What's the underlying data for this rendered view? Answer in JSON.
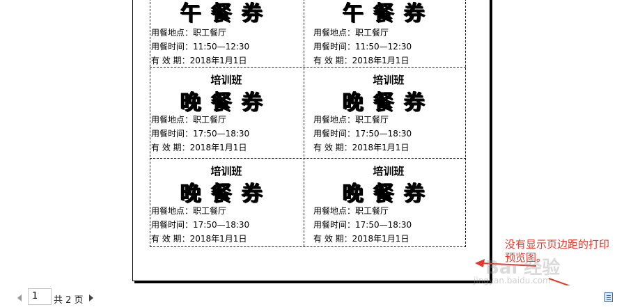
{
  "document": {
    "top_row": [
      {
        "big_title": "午餐券",
        "location": "用餐地点：职工餐厅",
        "time": "用餐时间：11:50—12:30",
        "valid": "有 效 期：2018年1月1日"
      },
      {
        "big_title": "午餐券",
        "location": "用餐地点：职工餐厅",
        "time": "用餐时间：11:50—12:30",
        "valid": "有 效 期：2018年1月1日"
      }
    ],
    "middle_row": [
      {
        "title": "培训班",
        "big_title": "晚餐券",
        "location": "用餐地点：职工餐厅",
        "time": "用餐时间：17:50—18:30",
        "valid": "有 效 期：2018年1月1日"
      },
      {
        "title": "培训班",
        "big_title": "晚餐券",
        "location": "用餐地点：职工餐厅",
        "time": "用餐时间：17:50—18:30",
        "valid": "有 效 期：2018年1月1日"
      }
    ],
    "bottom_row": [
      {
        "title": "培训班",
        "big_title": "晚餐券",
        "location": "用餐地点：职工餐厅",
        "time": "用餐时间：17:50—18:30",
        "valid": "有 效 期：2018年1月1日"
      },
      {
        "title": "培训班",
        "big_title": "晚餐券",
        "location": "用餐地点：职工餐厅",
        "time": "用餐时间：17:50—18:30",
        "valid": "有 效 期：2018年1月1日"
      }
    ]
  },
  "statusbar": {
    "page_value": "1",
    "page_total": "共 2 页",
    "icons": {
      "prev": "prev-page-icon",
      "next": "next-page-icon",
      "layout": "print-layout-icon"
    }
  },
  "annotation": {
    "text": "没有显示页边距的打印预览图。",
    "color": "#e23b2e"
  },
  "watermark": {
    "text": "Bai 经验",
    "sub": "jingyan.baidu.com"
  }
}
